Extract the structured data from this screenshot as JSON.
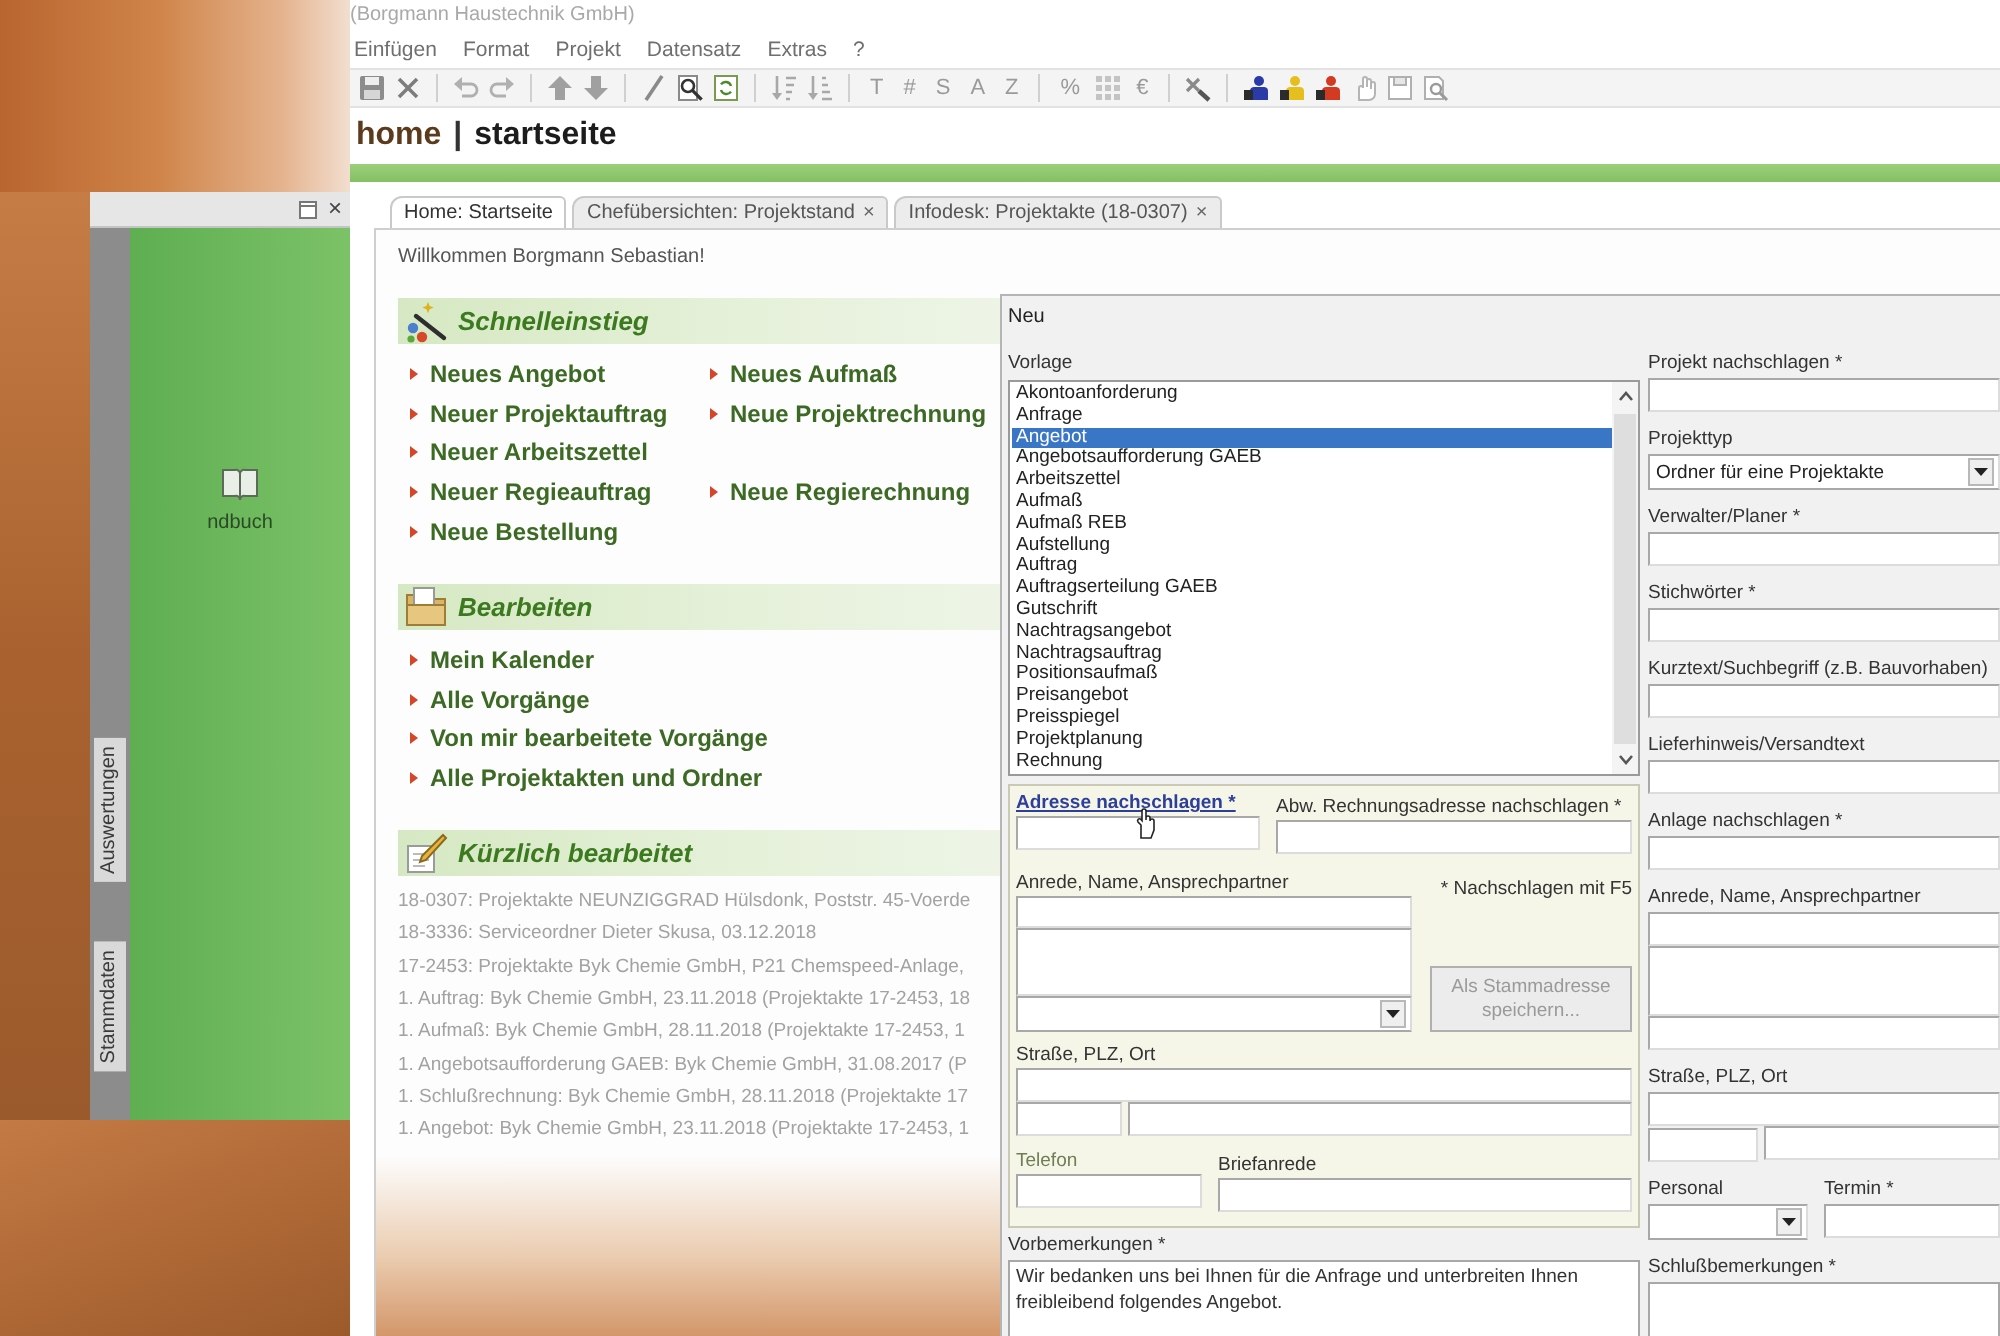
{
  "app": {
    "title": "(Borgmann Haustechnik GmbH)",
    "menu": [
      "Einfügen",
      "Format",
      "Projekt",
      "Datensatz",
      "Extras",
      "?"
    ],
    "toolbar": {
      "format_keys": [
        "T",
        "#",
        "S",
        "A",
        "Z"
      ],
      "unit_keys": [
        "%",
        "€"
      ]
    },
    "header": {
      "section": "home",
      "separator": "|",
      "page": "startseite"
    }
  },
  "sidebar": {
    "close": "×",
    "tabs": [
      "Auswertungen",
      "Stammdaten"
    ],
    "items": [
      {
        "label": "ndbuch"
      }
    ]
  },
  "tabs": [
    {
      "label": "Home: Startseite",
      "selected": true
    },
    {
      "label": "Chefübersichten: Projektstand",
      "selected": false,
      "close": "×"
    },
    {
      "label": "Infodesk: Projektakte (18-0307)",
      "selected": false,
      "close": "×"
    }
  ],
  "home": {
    "welcome": "Willkommen Borgmann Sebastian!",
    "sections": [
      {
        "kind": "links",
        "title": "Schnelleinstieg",
        "rows": [
          [
            "Neues Angebot",
            "Neues Aufmaß"
          ],
          [
            "Neuer Projektauftrag",
            "Neue Projektrechnung"
          ],
          [
            "Neuer Arbeitszettel"
          ],
          [
            "Neuer Regieauftrag",
            "Neue Regierechnung"
          ],
          [
            "Neue Bestellung"
          ]
        ]
      },
      {
        "kind": "links",
        "title": "Bearbeiten",
        "rows": [
          [
            "Mein Kalender"
          ],
          [
            "Alle Vorgänge"
          ],
          [
            "Von mir bearbeitete Vorgänge"
          ],
          [
            "Alle Projektakten und Ordner"
          ]
        ]
      },
      {
        "kind": "recent",
        "title": "Kürzlich bearbeitet",
        "items": [
          "18-0307: Projektakte NEUNZIGGRAD Hülsdonk, Poststr. 45-Voerde",
          "18-3336: Serviceordner Dieter Skusa, 03.12.2018",
          "17-2453: Projektakte Byk Chemie GmbH, P21 Chemspeed-Anlage,",
          "1. Auftrag: Byk Chemie GmbH, 23.11.2018 (Projektakte 17-2453, 18",
          "1. Aufmaß: Byk Chemie GmbH, 28.11.2018 (Projektakte 17-2453, 1",
          "1. Angebotsaufforderung GAEB: Byk Chemie GmbH, 31.08.2017 (P",
          "1. Schlußrechnung: Byk Chemie GmbH, 28.11.2018 (Projektakte 17",
          "1. Angebot: Byk Chemie GmbH, 23.11.2018 (Projektakte 17-2453, 1"
        ]
      }
    ]
  },
  "dialog": {
    "title": "Neu",
    "template_label": "Vorlage",
    "templates": [
      {
        "label": "Akontoanforderung",
        "selected": false
      },
      {
        "label": "Anfrage",
        "selected": false
      },
      {
        "label": "Angebot",
        "selected": true
      },
      {
        "label": "Angebotsaufforderung GAEB",
        "selected": false
      },
      {
        "label": "Arbeitszettel",
        "selected": false
      },
      {
        "label": "Aufmaß",
        "selected": false
      },
      {
        "label": "Aufmaß REB",
        "selected": false
      },
      {
        "label": "Aufstellung",
        "selected": false
      },
      {
        "label": "Auftrag",
        "selected": false
      },
      {
        "label": "Auftragserteilung GAEB",
        "selected": false
      },
      {
        "label": "Gutschrift",
        "selected": false
      },
      {
        "label": "Nachtragsangebot",
        "selected": false
      },
      {
        "label": "Nachtragsauftrag",
        "selected": false
      },
      {
        "label": "Positionsaufmaß",
        "selected": false
      },
      {
        "label": "Preisangebot",
        "selected": false
      },
      {
        "label": "Preisspiegel",
        "selected": false
      },
      {
        "label": "Projektplanung",
        "selected": false
      },
      {
        "label": "Rechnung",
        "selected": false
      }
    ],
    "address": {
      "lookup_link": "Adresse nachschlagen *",
      "billing_label": "Abw. Rechnungsadresse nachschlagen *",
      "contact_label": "Anrede, Name, Ansprechpartner",
      "hint": "* Nachschlagen mit F5",
      "save_button": {
        "label": "Als Stammadresse speichern...",
        "disabled": true
      },
      "street_label": "Straße, PLZ, Ort",
      "phone_label": "Telefon",
      "salutation_label": "Briefanrede"
    },
    "remarks": {
      "label": "Vorbemerkungen *",
      "value": "Wir bedanken uns bei Ihnen für die Anfrage und unterbreiten Ihnen freibleibend folgendes Angebot."
    },
    "right_fields": [
      {
        "kind": "input",
        "label": "Projekt nachschlagen *"
      },
      {
        "kind": "select",
        "label": "Projekttyp",
        "value": "Ordner für eine Projektakte"
      },
      {
        "kind": "input",
        "label": "Verwalter/Planer *"
      },
      {
        "kind": "input",
        "label": "Stichwörter *"
      },
      {
        "kind": "input",
        "label": "Kurztext/Suchbegriff (z.B. Bauvorhaben)"
      },
      {
        "kind": "input",
        "label": "Lieferhinweis/Versandtext"
      },
      {
        "kind": "input",
        "label": "Anlage nachschlagen *"
      },
      {
        "kind": "contact",
        "label": "Anrede, Name, Ansprechpartner"
      },
      {
        "kind": "street",
        "label": "Straße, PLZ, Ort"
      },
      {
        "kind": "split",
        "items": [
          {
            "kind": "select",
            "label": "Personal"
          },
          {
            "kind": "input",
            "label": "Termin *"
          }
        ]
      },
      {
        "kind": "textarea",
        "label": "Schlußbemerkungen *"
      }
    ]
  }
}
